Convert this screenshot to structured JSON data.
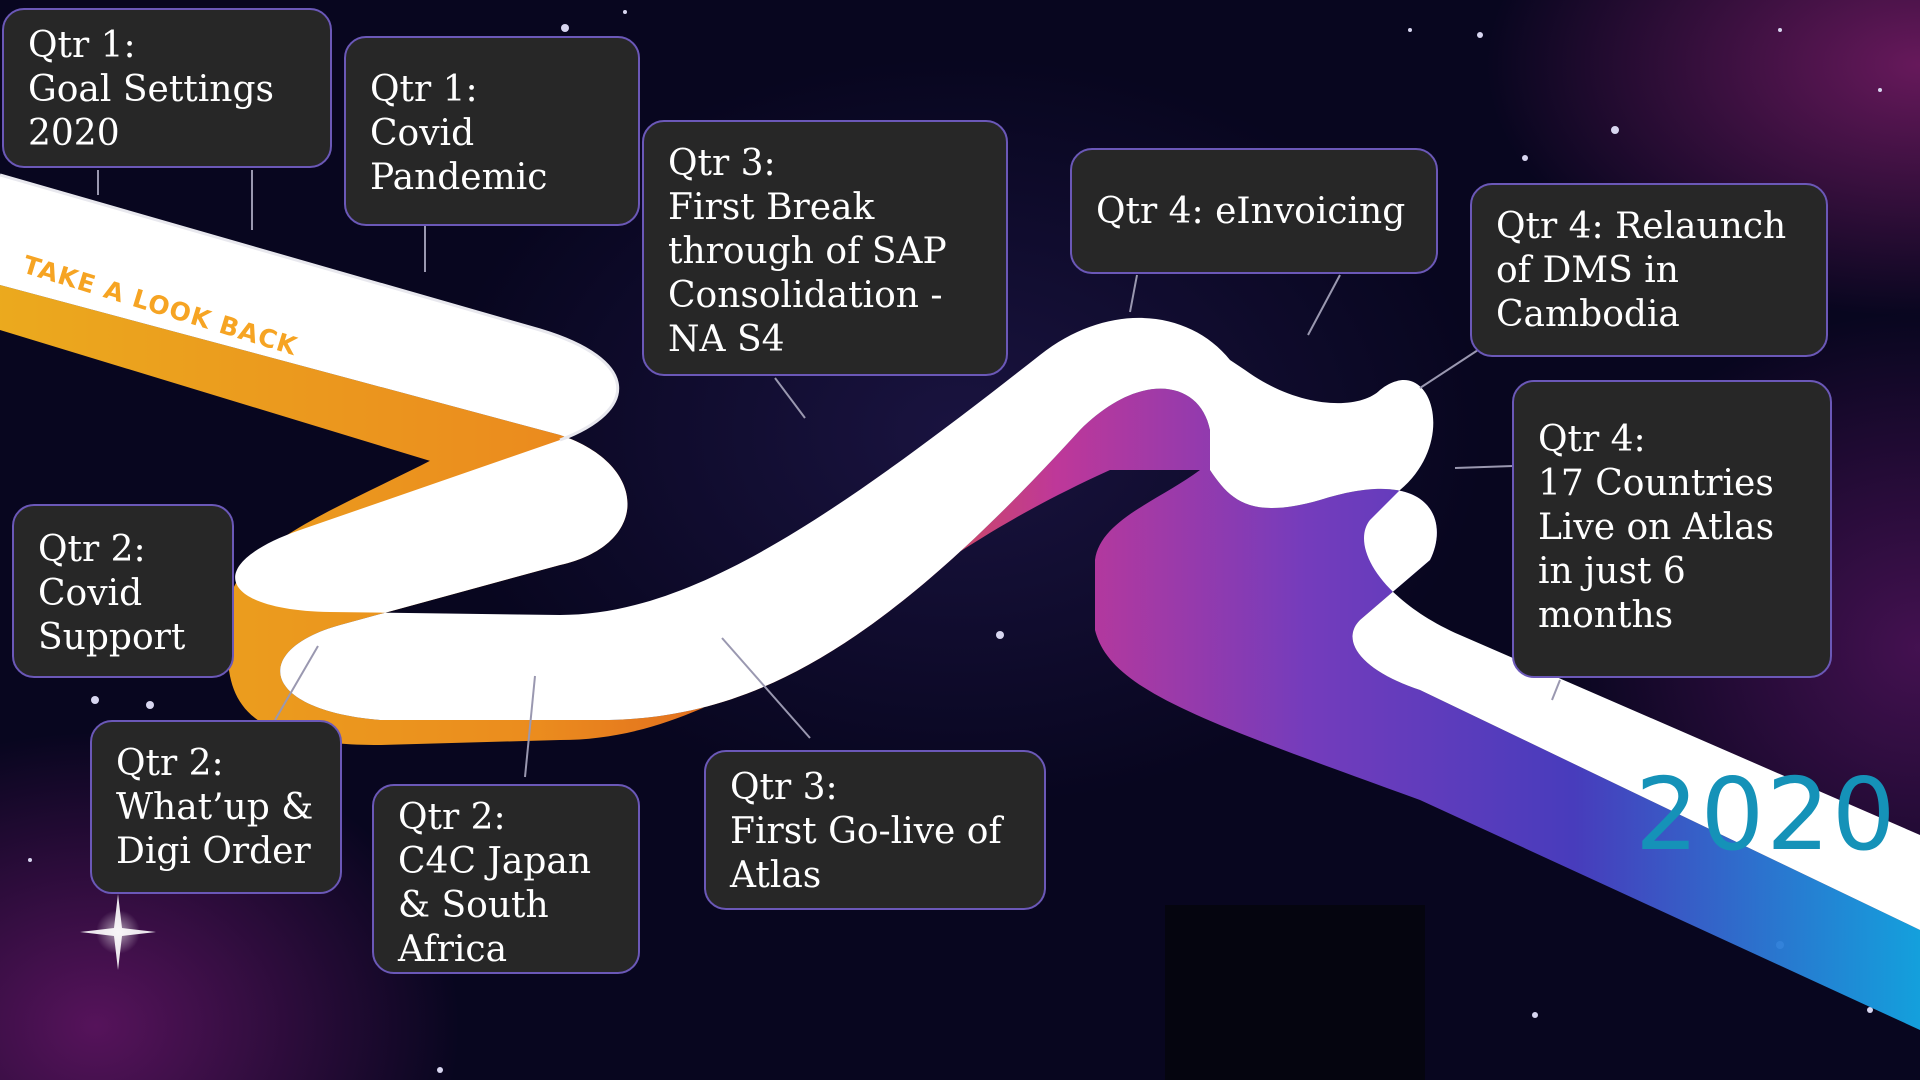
{
  "decor": {
    "banner_text": "TAKE A LOOK BACK",
    "year": "2020",
    "colors": {
      "background": "#08061f",
      "card_bg": "#272727",
      "card_border": "#6b58b8",
      "road_top": "#ffffff",
      "road_orange": "#f7931e",
      "road_magenta": "#c73a9e",
      "road_purple": "#7a3fc4",
      "road_blue": "#14a8e6",
      "year_color": "#1592b8"
    }
  },
  "milestones": [
    {
      "text": "Qtr 1:\nGoal Settings\n2020"
    },
    {
      "text": "Qtr 1:\nCovid\nPandemic"
    },
    {
      "text": "Qtr 3:\nFirst Break\nthrough of  SAP\nConsolidation -\nNA S4"
    },
    {
      "text": "Qtr 4: eInvoicing"
    },
    {
      "text": "Qtr 4: Relaunch\nof DMS in\nCambodia"
    },
    {
      "text": "Qtr 4:\n17 Countries\nLive on Atlas\nin just 6\nmonths"
    },
    {
      "text": "Qtr 2:\nCovid\nSupport"
    },
    {
      "text": "Qtr 2:\nWhat’up &\nDigi Order"
    },
    {
      "text": "Qtr 2:\nC4C  Japan\n& South\nAfrica"
    },
    {
      "text": "Qtr 3:\nFirst Go-live of\nAtlas"
    }
  ]
}
